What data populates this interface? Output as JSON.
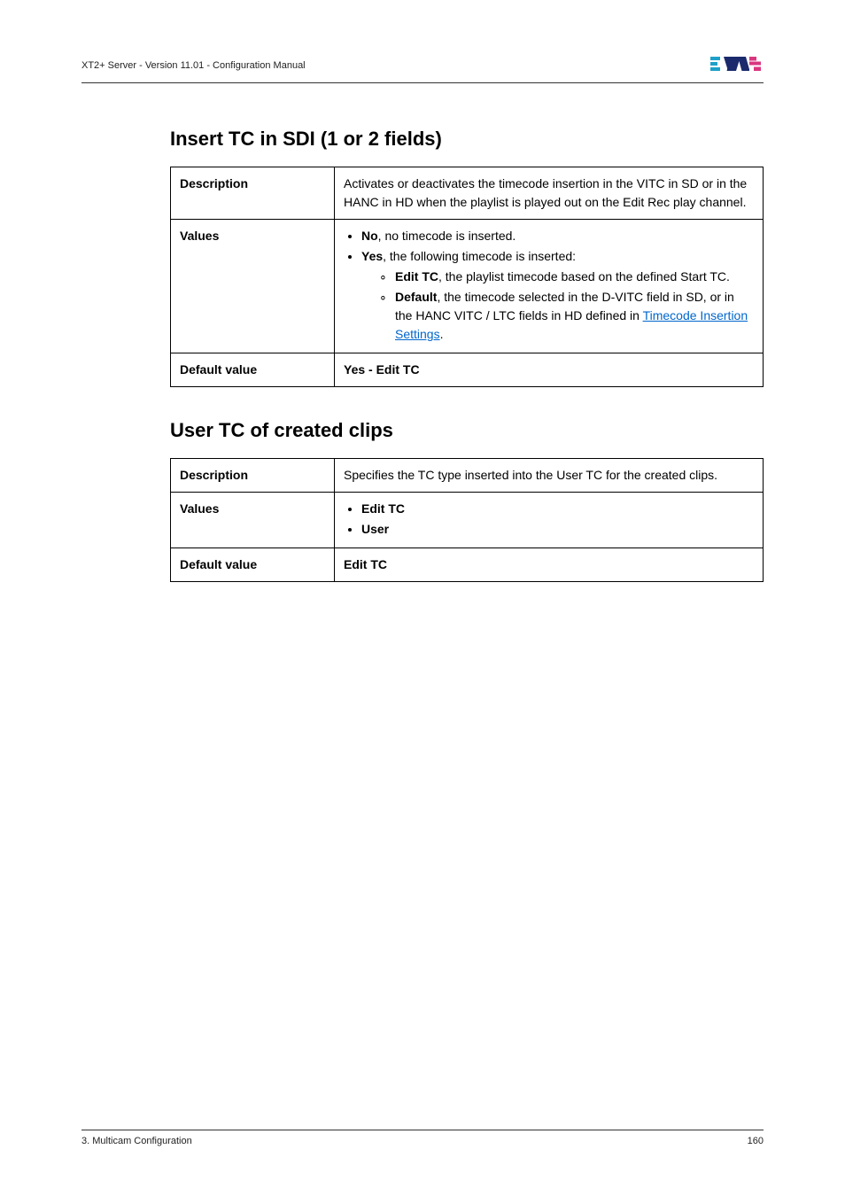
{
  "header": {
    "left": "XT2+ Server - Version 11.01 - Configuration Manual"
  },
  "section1": {
    "heading": "Insert TC in SDI (1 or 2 fields)",
    "rows": {
      "descLabel": "Description",
      "descValue": "Activates or deactivates the timecode insertion in the VITC in SD or in the HANC in HD when the playlist is played out on the Edit Rec play channel.",
      "valuesLabel": "Values",
      "values": {
        "b1_strong": "No",
        "b1_rest": ", no timecode is inserted.",
        "b2_strong": "Yes",
        "b2_rest": ", the following timecode is inserted:",
        "s1_strong": "Edit TC",
        "s1_rest": ", the playlist timecode based on the defined Start TC.",
        "s2_strong": "Default",
        "s2_rest": ", the timecode selected in the D-VITC field in SD, or in the HANC VITC / LTC fields in HD defined in ",
        "s2_link": "Timecode Insertion Settings",
        "s2_tail": "."
      },
      "defaultLabel": "Default value",
      "defaultValue": "Yes - Edit TC"
    }
  },
  "section2": {
    "heading": "User TC of created clips",
    "rows": {
      "descLabel": "Description",
      "descValue": "Specifies the TC type inserted into the User TC for the created clips.",
      "valuesLabel": "Values",
      "v1": "Edit TC",
      "v2": "User",
      "defaultLabel": "Default value",
      "defaultValue": "Edit TC"
    }
  },
  "footer": {
    "left": "3. Multicam Configuration",
    "right": "160"
  }
}
